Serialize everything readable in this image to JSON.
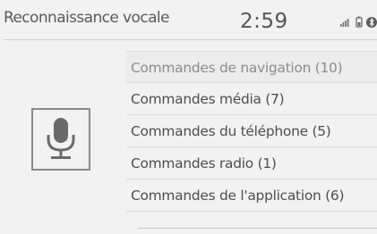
{
  "header": {
    "title": "Reconnaissance vocale",
    "time": "2:59"
  },
  "status_icons": [
    "signal-bars-icon",
    "battery-icon",
    "bluetooth-icon"
  ],
  "voice_icon": "microphone-icon",
  "menu": {
    "items": [
      {
        "label": "Commandes de navigation (10)"
      },
      {
        "label": "Commandes média (7)"
      },
      {
        "label": "Commandes du téléphone (5)"
      },
      {
        "label": "Commandes radio (1)"
      },
      {
        "label": "Commandes de l'application (6)"
      }
    ]
  },
  "colors": {
    "background": "#f2f2f2",
    "text": "#4e4e4e",
    "disabled_text": "#8c8c8c"
  }
}
